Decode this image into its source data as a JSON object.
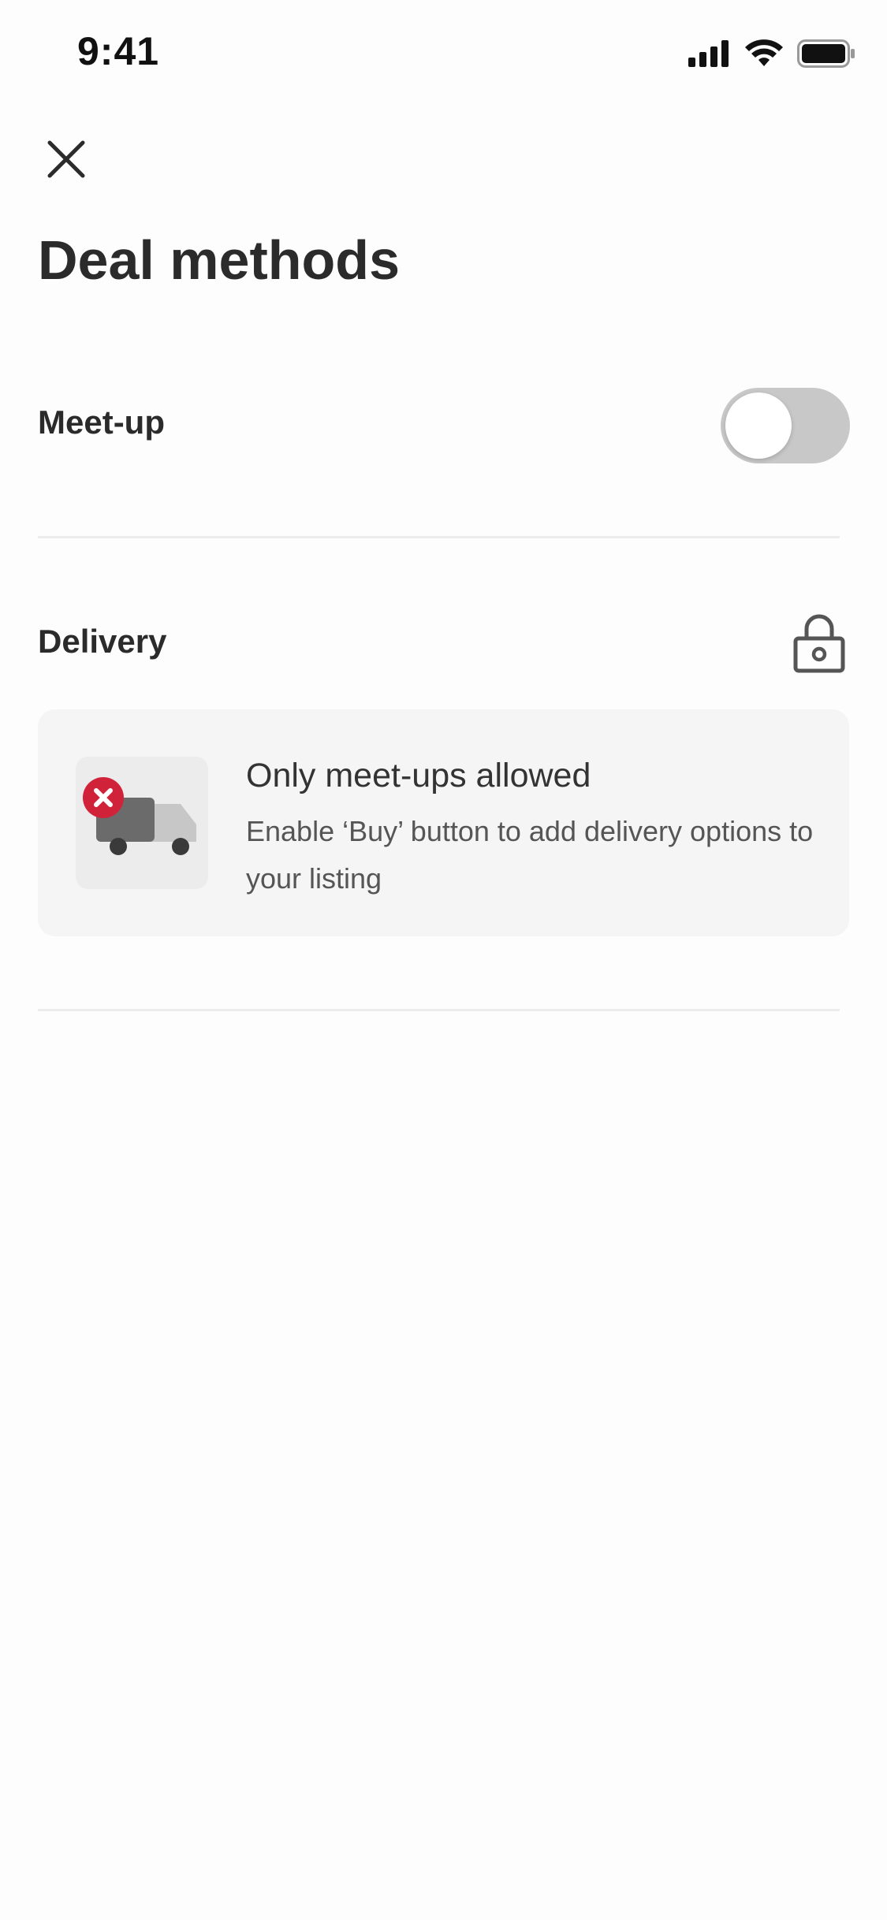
{
  "status_bar": {
    "time": "9:41",
    "icons": [
      "signal-icon",
      "wifi-icon",
      "battery-icon"
    ]
  },
  "header": {
    "close_icon": "close-icon",
    "title": "Deal methods"
  },
  "meetup": {
    "label": "Meet-up",
    "toggle_on": false
  },
  "delivery": {
    "label": "Delivery",
    "icon": "lock-icon",
    "card": {
      "icon": "truck-disabled-icon",
      "title": "Only meet-ups allowed",
      "body": "Enable ‘Buy’ button to add delivery options to your listing"
    }
  },
  "colors": {
    "text_primary": "#2b2b2b",
    "toggle_off": "#c8c8c8",
    "card_bg": "#f5f5f5",
    "error_badge": "#d0233a"
  }
}
